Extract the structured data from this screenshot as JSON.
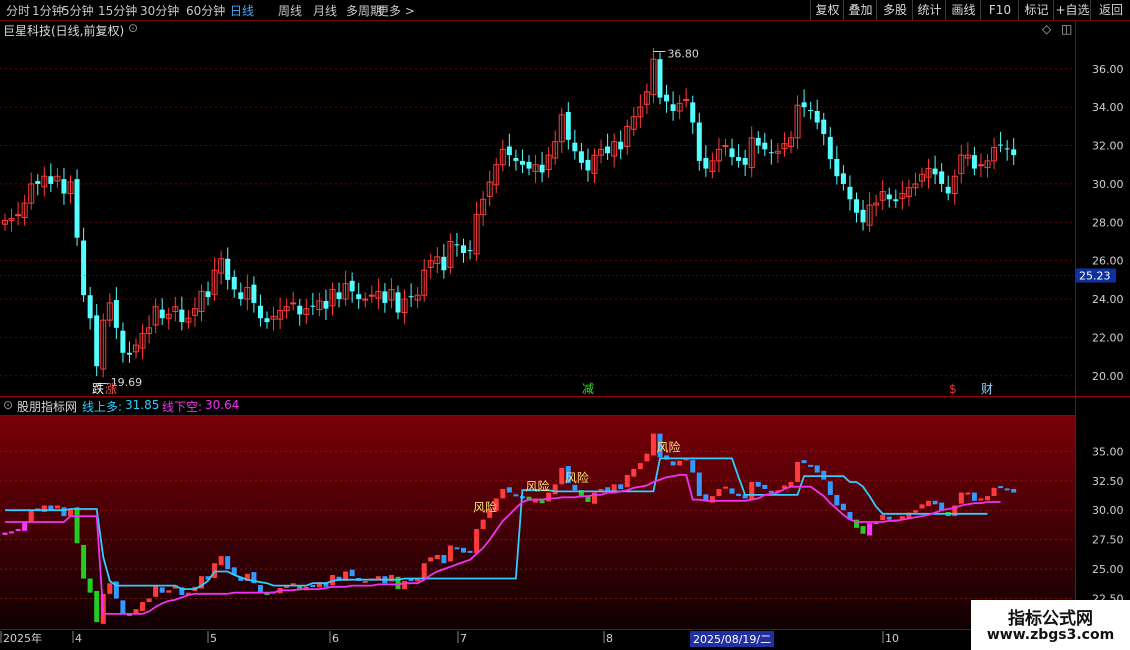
{
  "toolbar": {
    "periods": [
      "分时",
      "1分钟",
      "5分钟",
      "15分钟",
      "30分钟",
      "60分钟",
      "日线",
      "周线",
      "月线",
      "多周期",
      "更多 >"
    ],
    "active_period": "日线",
    "right_buttons": [
      "复权",
      "叠加",
      "多股",
      "统计",
      "画线",
      "F10",
      "标记",
      "+自选",
      "返回"
    ]
  },
  "main_chart": {
    "title": "巨星科技(日线,前复权)",
    "price_ticks": [
      "36.00",
      "34.00",
      "32.00",
      "30.00",
      "28.00",
      "26.00",
      "24.00",
      "22.00",
      "20.00"
    ],
    "current_price": "25.23",
    "high_label": "36.80",
    "low_label": "19.69",
    "markers": [
      {
        "text": "跌",
        "color": "#ffffff"
      },
      {
        "text": "涨",
        "color": "#ff5050"
      },
      {
        "text": "减",
        "color": "#33dd33"
      },
      {
        "text": "$",
        "color": "#ff3030"
      },
      {
        "text": "财",
        "color": "#9ad0ff"
      }
    ]
  },
  "indicator": {
    "name": "股朋指标网",
    "line_up_label": "线上多:",
    "line_up_value": "31.85",
    "line_down_label": "线下空:",
    "line_down_value": "30.64",
    "ticks": [
      "35.00",
      "32.50",
      "30.00",
      "27.50",
      "25.00",
      "22.50"
    ],
    "risk_labels": [
      "风险",
      "风险",
      "风险",
      "风险"
    ]
  },
  "date_axis": {
    "labels": [
      "2025年",
      "4",
      "5",
      "6",
      "7",
      "8",
      "10"
    ],
    "selected_date": "2025/08/19/二"
  },
  "watermark": {
    "line1": "指标公式网",
    "line2": "www.zbgs3.com"
  },
  "colors": {
    "up": "#ff3b3b",
    "down": "#54ffff",
    "indicator_green": "#22cc22",
    "indicator_magenta": "#ff33ff",
    "indicator_blue": "#3399ff",
    "upper_line": "#33ccff",
    "lower_line": "#ee33ee"
  },
  "chart_data": {
    "type": "candlestick",
    "ylim": [
      19.0,
      37.5
    ],
    "closes": [
      28.1,
      28.2,
      28.4,
      29.0,
      30.0,
      30.0,
      30.4,
      30.0,
      30.4,
      29.5,
      30.1,
      27.2,
      24.2,
      23.0,
      20.5,
      22.9,
      23.8,
      22.5,
      21.2,
      21.1,
      21.6,
      22.2,
      22.5,
      23.6,
      23.0,
      23.2,
      23.6,
      22.8,
      23.0,
      23.5,
      24.4,
      24.1,
      25.5,
      26.1,
      25.0,
      24.5,
      24.0,
      24.6,
      23.8,
      23.0,
      22.8,
      23.1,
      23.4,
      23.6,
      23.8,
      23.2,
      23.5,
      23.6,
      23.9,
      23.5,
      24.5,
      24.0,
      24.8,
      24.4,
      24.0,
      24.0,
      24.2,
      24.4,
      23.8,
      24.5,
      23.3,
      24.0,
      24.1,
      24.2,
      25.5,
      26.0,
      26.2,
      25.5,
      27.0,
      26.8,
      26.4,
      26.5,
      28.4,
      29.2,
      30.1,
      31.0,
      31.8,
      31.5,
      31.2,
      31.0,
      30.8,
      31.0,
      30.6,
      31.5,
      32.2,
      33.6,
      32.3,
      31.7,
      31.1,
      30.7,
      31.5,
      31.8,
      31.6,
      32.2,
      31.8,
      33.0,
      33.5,
      34.0,
      34.8,
      36.5,
      34.5,
      34.3,
      33.8,
      34.2,
      34.4,
      33.2,
      31.2,
      30.8,
      31.2,
      31.8,
      32.0,
      31.4,
      31.2,
      31.0,
      32.4,
      32.0,
      31.8,
      31.6,
      31.7,
      32.1,
      32.4,
      34.1,
      34.0,
      33.8,
      33.2,
      32.6,
      31.3,
      30.4,
      30.0,
      29.2,
      28.5,
      28.0,
      28.9,
      29.0,
      29.6,
      29.2,
      29.1,
      29.5,
      29.8,
      30.0,
      30.5,
      30.8,
      30.5,
      30.0,
      29.5,
      30.4,
      31.5,
      31.5,
      30.8,
      31.0,
      31.2,
      31.9,
      32.0,
      31.8,
      31.5
    ],
    "upper_line": [
      30.0,
      30.0,
      30.0,
      30.0,
      30.0,
      30.0,
      30.0,
      30.0,
      30.0,
      30.0,
      30.1,
      30.1,
      30.1,
      30.1,
      30.1,
      26.0,
      24.0,
      23.6,
      23.6,
      23.6,
      23.6,
      23.6,
      23.6,
      23.6,
      23.6,
      23.6,
      23.6,
      23.3,
      23.3,
      23.3,
      23.6,
      24.0,
      24.8,
      24.8,
      24.8,
      24.5,
      24.3,
      24.1,
      24.0,
      23.9,
      23.8,
      23.6,
      23.6,
      23.6,
      23.6,
      23.6,
      23.6,
      23.8,
      23.8,
      23.8,
      24.0,
      24.1,
      24.1,
      24.1,
      24.1,
      24.1,
      24.1,
      24.1,
      24.1,
      24.1,
      24.1,
      24.2,
      24.2,
      24.2,
      24.2,
      24.2,
      24.2,
      24.2,
      24.2,
      24.2,
      24.2,
      24.2,
      24.2,
      24.2,
      24.2,
      24.2,
      24.2,
      24.2,
      24.2,
      31.7,
      31.7,
      31.7,
      31.7,
      31.7,
      31.6,
      31.6,
      31.6,
      31.6,
      31.6,
      31.6,
      31.6,
      31.6,
      31.6,
      31.6,
      31.6,
      31.6,
      31.6,
      31.6,
      31.6,
      31.6,
      34.4,
      34.4,
      34.4,
      34.4,
      34.4,
      34.4,
      34.4,
      34.4,
      34.4,
      34.4,
      34.4,
      34.4,
      32.8,
      31.3,
      31.3,
      31.3,
      31.3,
      31.3,
      31.3,
      31.3,
      31.3,
      31.3,
      32.9,
      32.9,
      32.9,
      32.9,
      32.9,
      32.9,
      32.9,
      32.4,
      32.4,
      32.0,
      31.2,
      30.3,
      29.7,
      29.7,
      29.7,
      29.7,
      29.7,
      29.7,
      29.7,
      29.7,
      29.7,
      29.7,
      29.7,
      29.7,
      29.7,
      29.7,
      29.7,
      29.7,
      29.7
    ],
    "lower_line": [
      29.0,
      29.0,
      29.0,
      29.0,
      29.0,
      29.0,
      29.0,
      29.0,
      29.0,
      29.0,
      29.5,
      29.5,
      29.5,
      29.5,
      29.5,
      21.2,
      21.2,
      21.2,
      21.2,
      21.2,
      21.2,
      21.2,
      21.4,
      21.8,
      22.1,
      22.3,
      22.4,
      22.6,
      22.8,
      22.9,
      22.9,
      22.9,
      22.9,
      22.9,
      22.9,
      23.0,
      23.0,
      23.0,
      23.0,
      23.0,
      23.0,
      23.0,
      23.2,
      23.2,
      23.2,
      23.3,
      23.3,
      23.3,
      23.3,
      23.4,
      23.5,
      23.5,
      23.5,
      23.6,
      23.6,
      23.6,
      23.6,
      23.7,
      23.7,
      23.7,
      23.7,
      23.8,
      23.8,
      23.8,
      24.1,
      24.5,
      24.8,
      25.0,
      25.2,
      25.4,
      25.6,
      25.8,
      26.3,
      26.8,
      27.5,
      28.3,
      29.1,
      29.6,
      30.2,
      30.7,
      30.9,
      30.9,
      30.9,
      31.0,
      31.0,
      31.1,
      31.1,
      31.1,
      31.2,
      31.2,
      31.3,
      31.3,
      31.5,
      31.5,
      31.6,
      31.7,
      31.9,
      32.0,
      32.1,
      32.4,
      32.6,
      32.8,
      32.9,
      33.0,
      33.0,
      30.9,
      30.9,
      30.8,
      30.8,
      30.8,
      30.8,
      30.8,
      30.8,
      30.8,
      30.9,
      31.0,
      31.3,
      31.4,
      31.5,
      31.8,
      32.0,
      32.0,
      32.0,
      32.0,
      31.6,
      31.2,
      30.6,
      30.1,
      29.6,
      29.2,
      29.0,
      29.0,
      29.0,
      29.0,
      29.0,
      29.1,
      29.1,
      29.2,
      29.3,
      29.4,
      29.5,
      29.6,
      29.8,
      30.0,
      30.1,
      30.2,
      30.4,
      30.5,
      30.6,
      30.6,
      30.7,
      30.7,
      30.7
    ]
  }
}
